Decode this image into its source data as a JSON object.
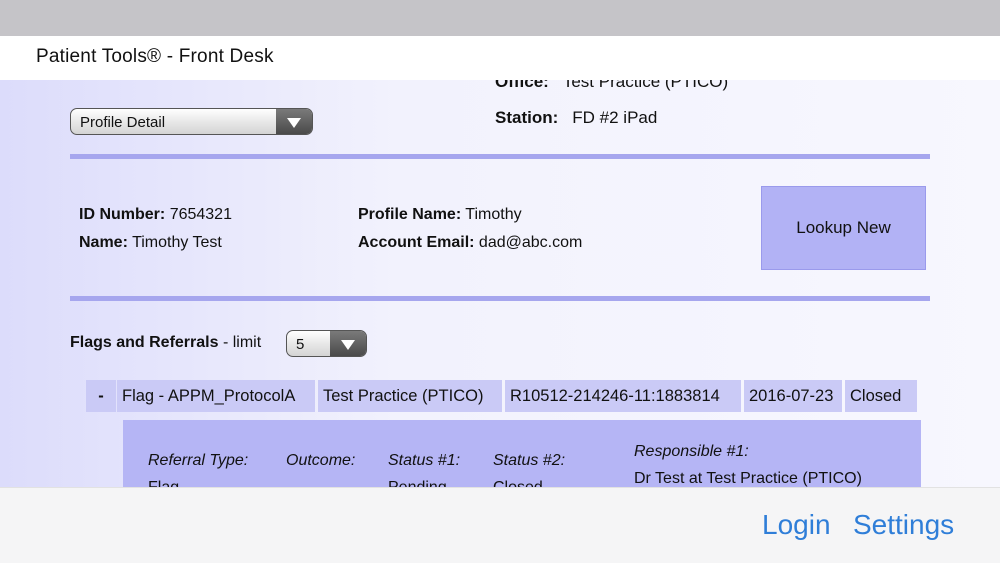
{
  "app": {
    "title": "Patient Tools® - Front Desk"
  },
  "header": {
    "office_label": "Office:",
    "office_value": "Test Practice (PTICO)",
    "station_label": "Station:",
    "station_value": "FD #2 iPad"
  },
  "view_select": {
    "value": "Profile Detail"
  },
  "profile": {
    "id_label": "ID Number:",
    "id_value": "7654321",
    "name_label": "Name:",
    "name_value": "Timothy Test",
    "profile_name_label": "Profile Name:",
    "profile_name_value": "Timothy",
    "email_label": "Account Email:",
    "email_value": "dad@abc.com"
  },
  "lookup_button": {
    "label": "Lookup New"
  },
  "flags": {
    "heading": "Flags and Referrals",
    "limit_text": "- limit",
    "limit_value": "5",
    "row": {
      "toggle": "-",
      "type": "Flag - APPM_ProtocolA",
      "practice": "Test Practice (PTICO)",
      "reference": "R10512-214246-11:1883814",
      "date": "2016-07-23",
      "status": "Closed"
    },
    "detail": {
      "referral_type_label": "Referral Type:",
      "referral_type_value": "Flag",
      "outcome_label": "Outcome:",
      "status1_label": "Status #1:",
      "status1_value": "Pending",
      "status2_label": "Status #2:",
      "status2_value": "Closed",
      "responsible_label": "Responsible #1:",
      "responsible_value": "Dr Test at Test Practice (PTICO)"
    }
  },
  "bottom": {
    "login": "Login",
    "settings": "Settings"
  },
  "colors": {
    "accent": "#2f7ed8",
    "panel": "#b2b2f5",
    "separator": "#a6a6ee",
    "cell": "#cacaf6"
  }
}
